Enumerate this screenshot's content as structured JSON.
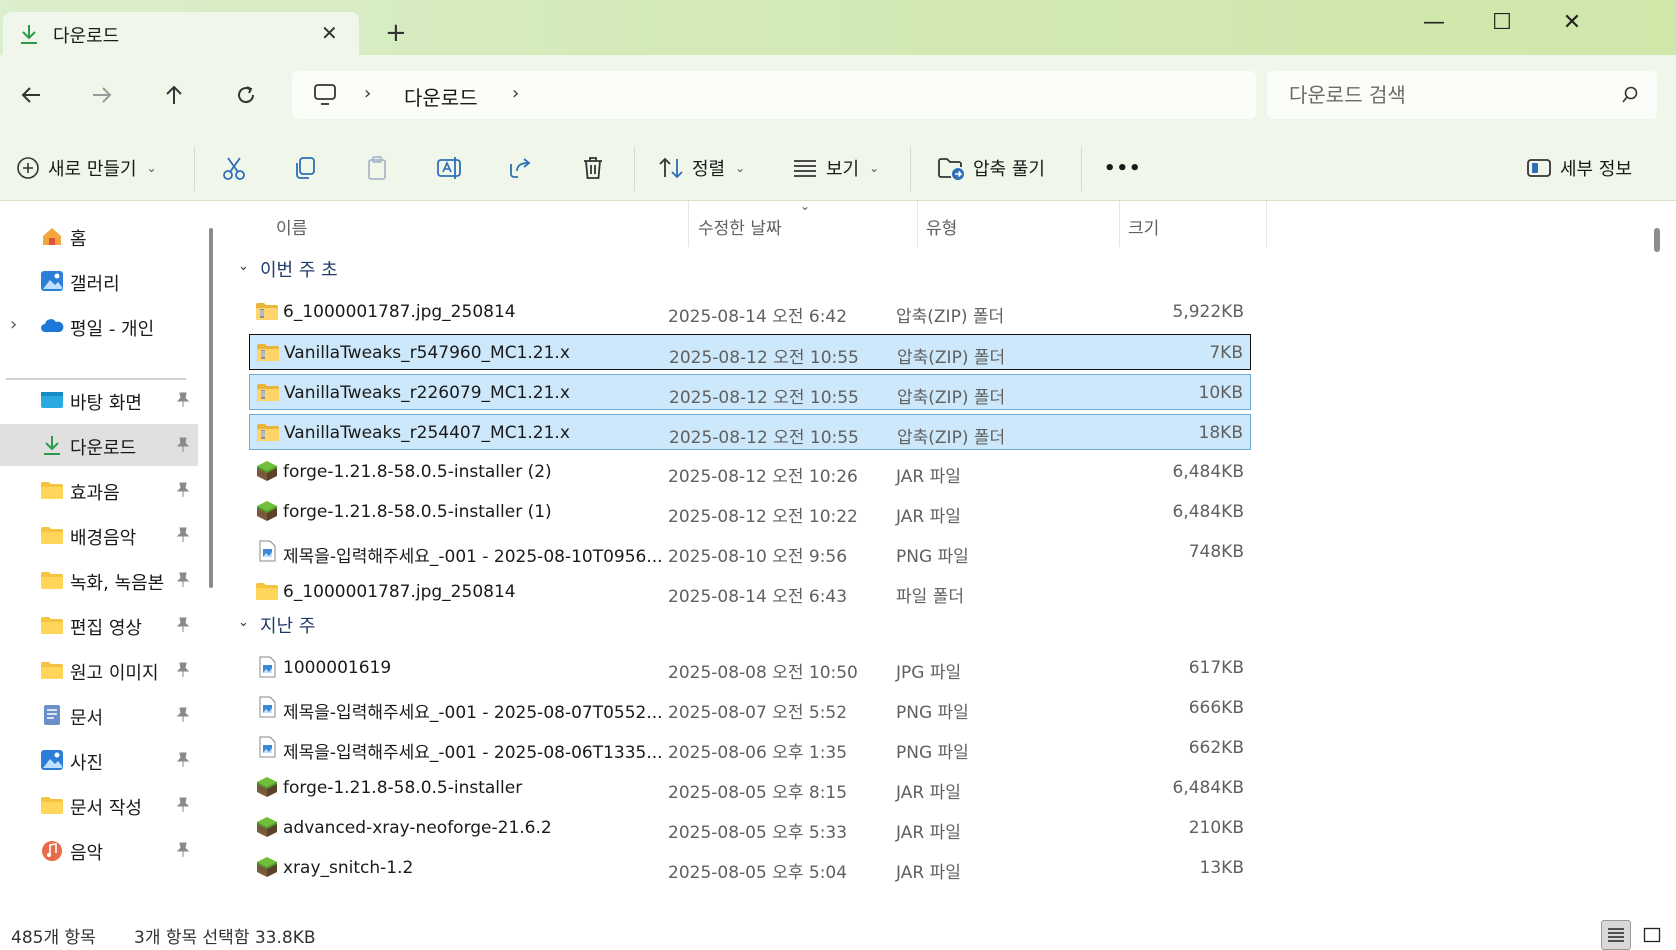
{
  "window": {
    "tab_title": "다운로드",
    "tab_close": "✕",
    "new_tab": "+",
    "minimize": "—",
    "maximize": "☐",
    "close": "✕"
  },
  "address": {
    "chevron": "›",
    "crumb": "다운로드",
    "search_placeholder": "다운로드 검색"
  },
  "commands": {
    "new_label": "새로 만들기",
    "sort_label": "정렬",
    "view_label": "보기",
    "extract_label": "압축 풀기",
    "more_label": "•••",
    "details_label": "세부 정보",
    "dropdown": "⌄"
  },
  "sidebar": {
    "top": [
      {
        "label": "홈",
        "icon": "home-icon"
      },
      {
        "label": "갤러리",
        "icon": "gallery-icon"
      },
      {
        "label": "평일 - 개인",
        "icon": "onedrive-icon"
      }
    ],
    "expand": "›",
    "pinned": [
      {
        "label": "바탕 화면",
        "icon": "desktop-icon"
      },
      {
        "label": "다운로드",
        "icon": "download-icon"
      },
      {
        "label": "효과음",
        "icon": "folder-icon"
      },
      {
        "label": "배경음악",
        "icon": "folder-icon"
      },
      {
        "label": "녹화, 녹음본",
        "icon": "folder-icon"
      },
      {
        "label": "편집 영상",
        "icon": "folder-icon"
      },
      {
        "label": "원고 이미지",
        "icon": "folder-icon"
      },
      {
        "label": "문서",
        "icon": "document-icon"
      },
      {
        "label": "사진",
        "icon": "pictures-icon"
      },
      {
        "label": "문서 작성",
        "icon": "folder-icon"
      },
      {
        "label": "음악",
        "icon": "music-icon"
      }
    ]
  },
  "columns": {
    "name": "이름",
    "date": "수정한 날짜",
    "type": "유형",
    "size": "크기",
    "sort_indicator": "⌄"
  },
  "groups": [
    {
      "label": "이번 주 초",
      "chevron": "⌄"
    },
    {
      "label": "지난 주",
      "chevron": "⌄"
    }
  ],
  "files": [
    {
      "name": "6_1000001787.jpg_250814",
      "date": "2025-08-14 오전 6:42",
      "type": "압축(ZIP) 폴더",
      "size": "5,922KB",
      "icon": "zip-folder-icon"
    },
    {
      "name": "VanillaTweaks_r547960_MC1.21.x",
      "date": "2025-08-12 오전 10:55",
      "type": "압축(ZIP) 폴더",
      "size": "7KB",
      "icon": "zip-folder-icon"
    },
    {
      "name": "VanillaTweaks_r226079_MC1.21.x",
      "date": "2025-08-12 오전 10:55",
      "type": "압축(ZIP) 폴더",
      "size": "10KB",
      "icon": "zip-folder-icon"
    },
    {
      "name": "VanillaTweaks_r254407_MC1.21.x",
      "date": "2025-08-12 오전 10:55",
      "type": "압축(ZIP) 폴더",
      "size": "18KB",
      "icon": "zip-folder-icon"
    },
    {
      "name": "forge-1.21.8-58.0.5-installer (2)",
      "date": "2025-08-12 오전 10:26",
      "type": "JAR 파일",
      "size": "6,484KB",
      "icon": "jar-icon"
    },
    {
      "name": "forge-1.21.8-58.0.5-installer (1)",
      "date": "2025-08-12 오전 10:22",
      "type": "JAR 파일",
      "size": "6,484KB",
      "icon": "jar-icon"
    },
    {
      "name": "제목을-입력해주세요_-001 - 2025-08-10T0956...",
      "date": "2025-08-10 오전 9:56",
      "type": "PNG 파일",
      "size": "748KB",
      "icon": "image-file-icon"
    },
    {
      "name": "6_1000001787.jpg_250814",
      "date": "2025-08-14 오전 6:43",
      "type": "파일 폴더",
      "size": "",
      "icon": "folder-icon"
    },
    {
      "name": "1000001619",
      "date": "2025-08-08 오전 10:50",
      "type": "JPG 파일",
      "size": "617KB",
      "icon": "image-file-icon"
    },
    {
      "name": "제목을-입력해주세요_-001 - 2025-08-07T0552...",
      "date": "2025-08-07 오전 5:52",
      "type": "PNG 파일",
      "size": "666KB",
      "icon": "image-file-icon"
    },
    {
      "name": "제목을-입력해주세요_-001 - 2025-08-06T1335...",
      "date": "2025-08-06 오후 1:35",
      "type": "PNG 파일",
      "size": "662KB",
      "icon": "image-file-icon"
    },
    {
      "name": "forge-1.21.8-58.0.5-installer",
      "date": "2025-08-05 오후 8:15",
      "type": "JAR 파일",
      "size": "6,484KB",
      "icon": "jar-icon"
    },
    {
      "name": "advanced-xray-neoforge-21.6.2",
      "date": "2025-08-05 오후 5:33",
      "type": "JAR 파일",
      "size": "210KB",
      "icon": "jar-icon"
    },
    {
      "name": "xray_snitch-1.2",
      "date": "2025-08-05 오후 5:04",
      "type": "JAR 파일",
      "size": "13KB",
      "icon": "jar-icon"
    }
  ],
  "status": {
    "count": "485개 항목",
    "selection": "3개 항목 선택함 33.8KB"
  },
  "colors": {
    "accent_green": "#cfe7a9",
    "toolbar_bg": "#f0f7ea",
    "selection": "#cde8fb",
    "group_text": "#1f3a6b"
  }
}
